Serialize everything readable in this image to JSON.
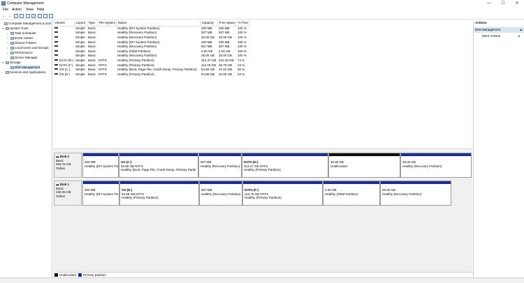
{
  "window": {
    "title": "Computer Management",
    "minimize": "—",
    "maximize": "☐",
    "close": "✕"
  },
  "menu": [
    "File",
    "Action",
    "View",
    "Help"
  ],
  "tree": [
    {
      "label": "Computer Management (Local",
      "icon": "computer-icon",
      "level": 0,
      "expander": ""
    },
    {
      "label": "System Tools",
      "icon": "tools-icon",
      "level": 1,
      "expander": "▾"
    },
    {
      "label": "Task Scheduler",
      "icon": "clock-icon",
      "level": 2,
      "expander": "›"
    },
    {
      "label": "Event Viewer",
      "icon": "event-icon",
      "level": 2,
      "expander": "›"
    },
    {
      "label": "Shared Folders",
      "icon": "folder-icon",
      "level": 2,
      "expander": "›"
    },
    {
      "label": "Local Users and Groups",
      "icon": "users-icon",
      "level": 2,
      "expander": "›"
    },
    {
      "label": "Performance",
      "icon": "performance-icon",
      "level": 2,
      "expander": "›"
    },
    {
      "label": "Device Manager",
      "icon": "device-icon",
      "level": 2,
      "expander": ""
    },
    {
      "label": "Storage",
      "icon": "storage-icon",
      "level": 1,
      "expander": "▾"
    },
    {
      "label": "Disk Management",
      "icon": "disk-icon",
      "level": 2,
      "expander": "",
      "selected": true
    },
    {
      "label": "Services and Applications",
      "icon": "services-icon",
      "level": 1,
      "expander": "›"
    }
  ],
  "volumes": {
    "columns": [
      "Volume",
      "Layout",
      "Type",
      "File System",
      "Status",
      "Capacity",
      "Free Space",
      "% Free"
    ],
    "rows": [
      [
        "",
        "Simple",
        "Basic",
        "",
        "Healthy (EFI System Partition)",
        "200 MB",
        "200 MB",
        "100 %"
      ],
      [
        "",
        "Simple",
        "Basic",
        "",
        "Healthy (Recovery Partition)",
        "507 MB",
        "507 MB",
        "100 %"
      ],
      [
        "",
        "Simple",
        "Basic",
        "",
        "Healthy (Recovery Partition)",
        "25.00 GB",
        "25.00 GB",
        "100 %"
      ],
      [
        "",
        "Simple",
        "Basic",
        "",
        "Healthy (EFI System Partition)",
        "200 MB",
        "200 MB",
        "100 %"
      ],
      [
        "",
        "Simple",
        "Basic",
        "",
        "Healthy (Recovery Partition)",
        "507 MB",
        "507 MB",
        "100 %"
      ],
      [
        "",
        "Simple",
        "Basic",
        "",
        "Healthy (OEM Partition)",
        "4.00 GB",
        "4.00 GB",
        "100 %"
      ],
      [
        "",
        "Simple",
        "Basic",
        "",
        "Healthy (Recovery Partition)",
        "25.00 GB",
        "25.00 GB",
        "100 %"
      ],
      [
        "DATA (D:)",
        "Simple",
        "Basic",
        "NTFS",
        "Healthy (Primary Partition)",
        "314.47 GB",
        "231.49 GB",
        "74 %"
      ],
      [
        "DATA (F:)",
        "Simple",
        "Basic",
        "NTFS",
        "Healthy (Primary Partition)",
        "113.79 GB",
        "25.79 GB",
        "23 %"
      ],
      [
        "OS (C:)",
        "Simple",
        "Basic",
        "NTFS",
        "Healthy (Boot, Page File, Crash Dump, Primary Partition)",
        "94.89 GB",
        "24.23 GB",
        "26 %"
      ],
      [
        "OS (E:)",
        "Simple",
        "Basic",
        "NTFS",
        "Healthy (Primary Partition)",
        "94.89 GB",
        "22.09 GB",
        "23 %"
      ]
    ]
  },
  "disks": [
    {
      "name": "Disk 0",
      "type": "Basic",
      "size": "465.76 GB",
      "state": "Online",
      "partitions": [
        {
          "name": "",
          "size": "200 MB",
          "status": "Healthy (EFI System Pa",
          "kind": "primary"
        },
        {
          "name": "OS (C:)",
          "size": "94.89 GB NTFS",
          "status": "Healthy (Boot, Page File, Crash Dump, Primary Partiti",
          "kind": "primary"
        },
        {
          "name": "",
          "size": "507 MB",
          "status": "Healthy (Recovery Partition)",
          "kind": "primary"
        },
        {
          "name": "DATA (D:)",
          "size": "314.47 GB NTFS",
          "status": "Healthy (Primary Partition)",
          "kind": "primary"
        },
        {
          "name": "",
          "size": "30.59 GB",
          "status": "Unallocated",
          "kind": "unallocated"
        },
        {
          "name": "",
          "size": "25.00 GB",
          "status": "Healthy (Recovery Partition)",
          "kind": "primary"
        }
      ]
    },
    {
      "name": "Disk 1",
      "type": "Basic",
      "size": "238.35 GB",
      "state": "Online",
      "partitions": [
        {
          "name": "",
          "size": "200 MB",
          "status": "Healthy (EFI System Pa",
          "kind": "primary"
        },
        {
          "name": "OS (E:)",
          "size": "94.89 GB NTFS",
          "status": "Healthy (Primary Partition)",
          "kind": "primary"
        },
        {
          "name": "",
          "size": "507 MB",
          "status": "Healthy (Recovery Partition)",
          "kind": "primary"
        },
        {
          "name": "DATA (F:)",
          "size": "113.79 GB NTFS",
          "status": "Healthy (Primary Partition)",
          "kind": "primary"
        },
        {
          "name": "",
          "size": "4.00 GB",
          "status": "Healthy (OEM Partition)",
          "kind": "primary"
        },
        {
          "name": "",
          "size": "25.00 GB",
          "status": "Healthy (Recovery Partition)",
          "kind": "primary"
        }
      ]
    }
  ],
  "legend": {
    "unallocated": "Unallocated",
    "primary": "Primary partition"
  },
  "actions": {
    "title": "Actions",
    "section": "Disk Management",
    "item": "More Actions",
    "chevron_up": "▲",
    "chevron_right": "▸"
  },
  "colors": {
    "primary_partition": "#1d2f8c",
    "unallocated": "#111111",
    "selection": "#cce4f7"
  }
}
